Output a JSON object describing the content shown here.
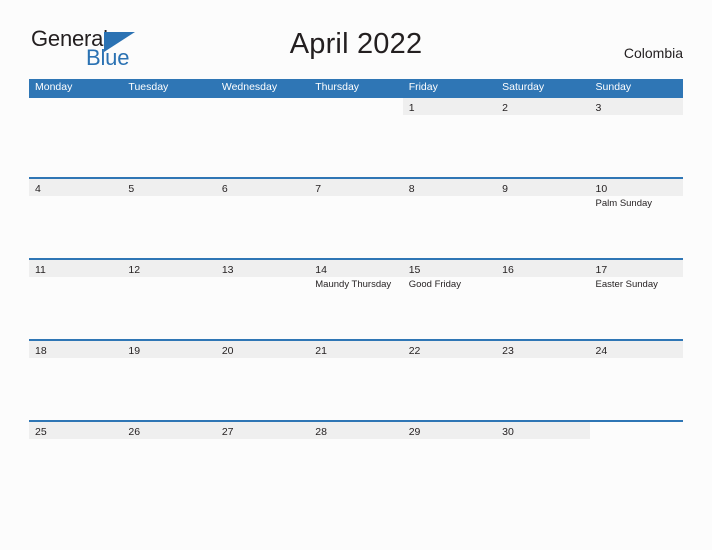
{
  "brand": {
    "name_part1": "General",
    "name_part2": "Blue",
    "triangle_icon": "triangle-icon",
    "accent_color": "#2b72b3"
  },
  "header": {
    "title": "April 2022",
    "country": "Colombia"
  },
  "theme": {
    "header_blue": "#2f76b5",
    "band_gray": "#efefef",
    "page_background": "#fcfcfc",
    "text_color": "#231f20"
  },
  "calendar": {
    "month": "April",
    "year": "2022",
    "weekday_headers": [
      "Monday",
      "Tuesday",
      "Wednesday",
      "Thursday",
      "Friday",
      "Saturday",
      "Sunday"
    ],
    "weeks": [
      {
        "days": [
          {
            "number": "",
            "blank": true,
            "events": []
          },
          {
            "number": "",
            "blank": true,
            "events": []
          },
          {
            "number": "",
            "blank": true,
            "events": []
          },
          {
            "number": "",
            "blank": true,
            "events": []
          },
          {
            "number": "1",
            "blank": false,
            "events": []
          },
          {
            "number": "2",
            "blank": false,
            "events": []
          },
          {
            "number": "3",
            "blank": false,
            "events": []
          }
        ]
      },
      {
        "days": [
          {
            "number": "4",
            "blank": false,
            "events": []
          },
          {
            "number": "5",
            "blank": false,
            "events": []
          },
          {
            "number": "6",
            "blank": false,
            "events": []
          },
          {
            "number": "7",
            "blank": false,
            "events": []
          },
          {
            "number": "8",
            "blank": false,
            "events": []
          },
          {
            "number": "9",
            "blank": false,
            "events": []
          },
          {
            "number": "10",
            "blank": false,
            "events": [
              "Palm Sunday"
            ]
          }
        ]
      },
      {
        "days": [
          {
            "number": "11",
            "blank": false,
            "events": []
          },
          {
            "number": "12",
            "blank": false,
            "events": []
          },
          {
            "number": "13",
            "blank": false,
            "events": []
          },
          {
            "number": "14",
            "blank": false,
            "events": [
              "Maundy Thursday"
            ]
          },
          {
            "number": "15",
            "blank": false,
            "events": [
              "Good Friday"
            ]
          },
          {
            "number": "16",
            "blank": false,
            "events": []
          },
          {
            "number": "17",
            "blank": false,
            "events": [
              "Easter Sunday"
            ]
          }
        ]
      },
      {
        "days": [
          {
            "number": "18",
            "blank": false,
            "events": []
          },
          {
            "number": "19",
            "blank": false,
            "events": []
          },
          {
            "number": "20",
            "blank": false,
            "events": []
          },
          {
            "number": "21",
            "blank": false,
            "events": []
          },
          {
            "number": "22",
            "blank": false,
            "events": []
          },
          {
            "number": "23",
            "blank": false,
            "events": []
          },
          {
            "number": "24",
            "blank": false,
            "events": []
          }
        ]
      },
      {
        "days": [
          {
            "number": "25",
            "blank": false,
            "events": []
          },
          {
            "number": "26",
            "blank": false,
            "events": []
          },
          {
            "number": "27",
            "blank": false,
            "events": []
          },
          {
            "number": "28",
            "blank": false,
            "events": []
          },
          {
            "number": "29",
            "blank": false,
            "events": []
          },
          {
            "number": "30",
            "blank": false,
            "events": []
          },
          {
            "number": "",
            "blank": true,
            "events": []
          }
        ]
      }
    ]
  }
}
